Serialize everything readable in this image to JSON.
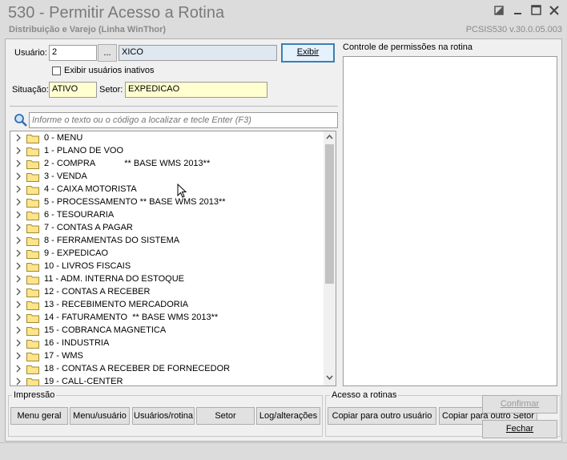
{
  "window": {
    "title": "530 - Permitir Acesso a Rotina",
    "subtitle": "Distribuição e Varejo (Linha WinThor)",
    "version": "PCSIS530  v.30.0.05.003"
  },
  "form": {
    "usuario_label": "Usuário:",
    "usuario_value": "2",
    "lookup_button": "...",
    "usuario_name": "XICO",
    "exibir_button": "Exibir",
    "exibir_inativos_label": "Exibir usuários inativos",
    "situacao_label": "Situação:",
    "situacao_value": "ATIVO",
    "setor_label": "Setor:",
    "setor_value": "EXPEDICAO"
  },
  "search": {
    "placeholder": "Informe o texto ou o código a localizar e tecle Enter (F3)"
  },
  "tree": {
    "items": [
      "0 - MENU",
      "1 - PLANO DE VOO",
      "2 - COMPRA            ** BASE WMS 2013**",
      "3 - VENDA",
      "4 - CAIXA MOTORISTA",
      "5 - PROCESSAMENTO ** BASE WMS 2013**",
      "6 - TESOURARIA",
      "7 - CONTAS A PAGAR",
      "8 - FERRAMENTAS DO SISTEMA",
      "9 - EXPEDICAO",
      "10 - LIVROS FISCAIS",
      "11 - ADM. INTERNA DO ESTOQUE",
      "12 - CONTAS A RECEBER",
      "13 - RECEBIMENTO MERCADORIA",
      "14 - FATURAMENTO  ** BASE WMS 2013**",
      "15 - COBRANCA MAGNETICA",
      "16 - INDUSTRIA",
      "17 - WMS",
      "18 - CONTAS A RECEBER DE FORNECEDOR",
      "19 - CALL-CENTER"
    ]
  },
  "permissions": {
    "label": "Controle de permissões na rotina"
  },
  "impressao": {
    "title": "Impressão",
    "buttons": [
      "Menu geral",
      "Menu/usuário",
      "Usuários/rotina",
      "Setor",
      "Log/alterações"
    ]
  },
  "acesso": {
    "title": "Acesso a rotinas",
    "copy_user": "Copiar para outro usuário",
    "copy_sector": "Copiar para outro Setor"
  },
  "actions": {
    "confirmar": "Confirmar",
    "fechar": "Fechar"
  },
  "colors": {
    "accent": "#3c7fb1",
    "input_highlight": "#ffffd0",
    "folder": "#ffe48a"
  }
}
